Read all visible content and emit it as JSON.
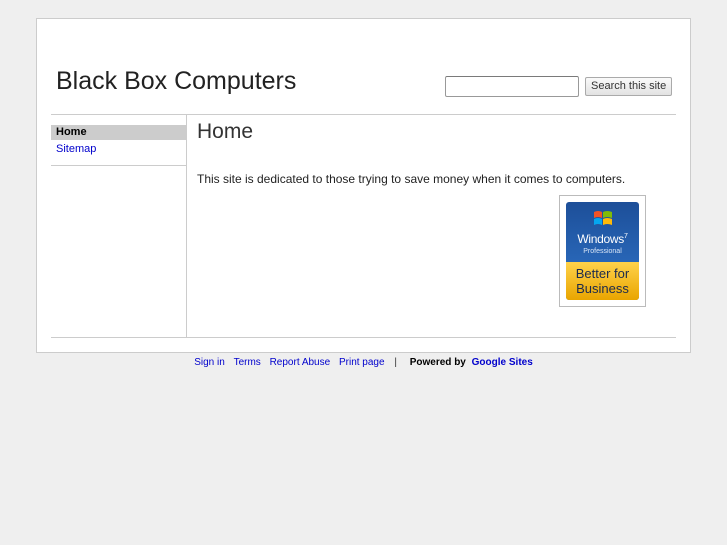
{
  "site": {
    "title": "Black Box Computers"
  },
  "search": {
    "placeholder": "",
    "button_label": "Search this site"
  },
  "sidebar": {
    "items": [
      {
        "label": "Home",
        "active": true
      },
      {
        "label": "Sitemap",
        "active": false
      }
    ]
  },
  "main": {
    "title": "Home",
    "text": "This site is dedicated to those trying to save money when it comes to computers."
  },
  "badge": {
    "brand": "Windows",
    "version": "7",
    "edition": "Professional",
    "tagline_line1": "Better for",
    "tagline_line2": "Business",
    "logo_icon": "windows-logo-icon"
  },
  "footer": {
    "links": [
      "Sign in",
      "Terms",
      "Report Abuse",
      "Print page"
    ],
    "separator": "|",
    "powered_by": "Powered by",
    "powered_brand": "Google Sites"
  },
  "colors": {
    "page_bg": "#efefef",
    "link": "#0000cc",
    "nav_active_bg": "#cccccc",
    "badge_blue": "#2f74c9",
    "badge_gold": "#f5b800"
  }
}
